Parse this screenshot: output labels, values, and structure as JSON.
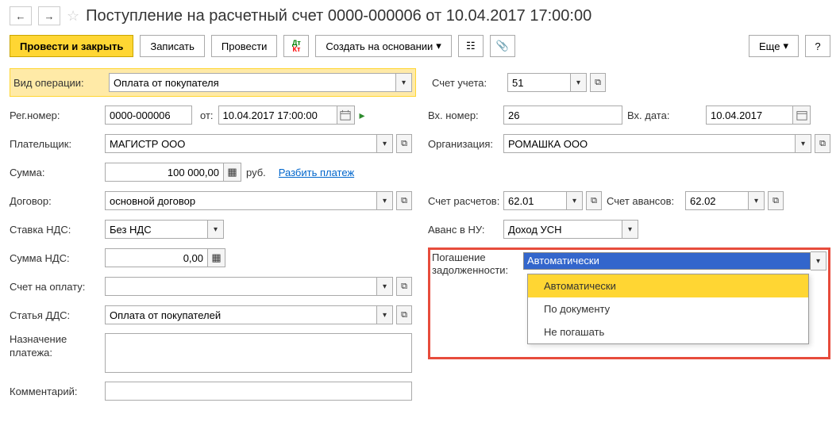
{
  "header": {
    "title": "Поступление на расчетный счет 0000-000006 от 10.04.2017 17:00:00"
  },
  "toolbar": {
    "post_close": "Провести и закрыть",
    "save": "Записать",
    "post": "Провести",
    "create_based": "Создать на основании",
    "more": "Еще"
  },
  "left": {
    "op_type_label": "Вид операции:",
    "op_type": "Оплата от покупателя",
    "reg_num_label": "Рег.номер:",
    "reg_num": "0000-000006",
    "from_label": "от:",
    "date": "10.04.2017 17:00:00",
    "payer_label": "Плательщик:",
    "payer": "МАГИСТР ООО",
    "sum_label": "Сумма:",
    "sum": "100 000,00",
    "currency": "руб.",
    "split_link": "Разбить платеж",
    "contract_label": "Договор:",
    "contract": "основной договор",
    "vat_rate_label": "Ставка НДС:",
    "vat_rate": "Без НДС",
    "vat_sum_label": "Сумма НДС:",
    "vat_sum": "0,00",
    "invoice_label": "Счет на оплату:",
    "invoice": "",
    "dds_label": "Статья ДДС:",
    "dds": "Оплата от покупателей",
    "purpose_label": "Назначение платежа:",
    "purpose": "",
    "comment_label": "Комментарий:",
    "comment": ""
  },
  "right": {
    "account_label": "Счет учета:",
    "account": "51",
    "in_num_label": "Вх. номер:",
    "in_num": "26",
    "in_date_label": "Вх. дата:",
    "in_date": "10.04.2017",
    "org_label": "Организация:",
    "org": "РОМАШКА ООО",
    "calc_acc_label": "Счет расчетов:",
    "calc_acc": "62.01",
    "adv_acc_label": "Счет авансов:",
    "adv_acc": "62.02",
    "adv_tax_label": "Аванс в НУ:",
    "adv_tax": "Доход УСН",
    "debt_label": "Погашение задолженности:",
    "debt_value": "Автоматически",
    "debt_options": {
      "auto": "Автоматически",
      "by_doc": "По документу",
      "no_repay": "Не погашать"
    }
  }
}
